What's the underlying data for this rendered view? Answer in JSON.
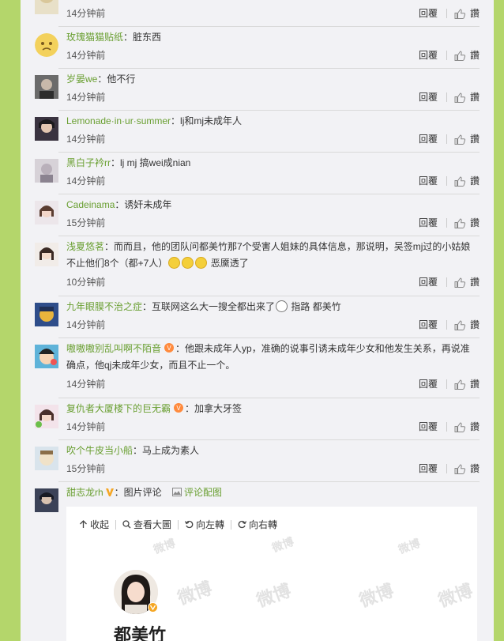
{
  "actions": {
    "reply_label": "回覆",
    "like_label": "讚"
  },
  "comments": [
    {
      "user": "",
      "text": "",
      "time": "14分钟前"
    },
    {
      "user": "玫瑰猫猫贴纸",
      "text": "：脏东西",
      "time": "14分钟前"
    },
    {
      "user": "岁晏we",
      "text": "：他不行",
      "time": "14分钟前"
    },
    {
      "user": "Lemonade·in·ur·summer",
      "text": "：lj和mj未成年人",
      "time": "14分钟前"
    },
    {
      "user": "黑白子衿rr",
      "text": "：lj mj 搞wei成nian",
      "time": "14分钟前"
    },
    {
      "user": "Cadeinama",
      "text": "：诱奸未成年",
      "time": "15分钟前"
    },
    {
      "user": "浅夏悠茗",
      "text": "：而而且，他的团队问都美竹那7个受害人姐妹的具体信息，那说明，吴签mj过的小姑娘",
      "text2": "不止他们8个（都+7人）",
      "text3": " 恶黡透了",
      "time": "10分钟前"
    },
    {
      "user": "九年眼膜不治之症",
      "text": "：互联网这么大一搜全都出来了",
      "text2": " 指路 都美竹",
      "time": "14分钟前"
    },
    {
      "user": "嗷嗷嗷别乱叫啊不陌音",
      "text": "：他跟未成年人yp，准确的说事引诱未成年少女和他发生关系，再说准",
      "text2": "确点，他qj未成年少女，而且不止一个。",
      "time": "14分钟前"
    },
    {
      "user": "复仇者大厦楼下的巨无霸",
      "text": "：加拿大牙签",
      "time": "14分钟前"
    },
    {
      "user": "吹个牛皮当小船",
      "text": "：马上成为素人",
      "time": "15分钟前"
    }
  ],
  "last_comment": {
    "user": "甜志龙rh",
    "text": "：图片评论",
    "pic_comment_label": "评论配图"
  },
  "viewer": {
    "collapse_label": "收起",
    "view_large_label": "查看大圖",
    "rotate_left_label": "向左轉",
    "rotate_right_label": "向右轉",
    "watermark": "微博",
    "name": "都美竹"
  },
  "colors": {
    "username": "#699f31",
    "page_bg": "#b4d66b",
    "panel_bg": "#f2f2f5"
  }
}
